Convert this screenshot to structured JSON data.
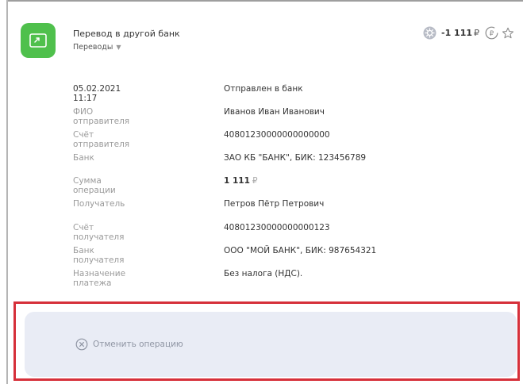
{
  "header": {
    "title": "Перевод в другой банк",
    "category": "Переводы",
    "amount": "-1 111",
    "currency": "₽"
  },
  "colors": {
    "app_icon_bg": "#4fc04c",
    "highlight_border": "#d6303a",
    "panel_bg": "#e9ecf5"
  },
  "icons": {
    "app": "transfer-arrows-icon",
    "bonus": "bonus-badge-icon",
    "cashback": "rouble-cashback-icon",
    "favorite": "star-icon",
    "cancel": "close-circle-icon"
  },
  "details": {
    "datetime": "05.02.2021 11:17",
    "status": "Отправлен в банк",
    "rows": [
      {
        "label": "ФИО отправителя",
        "value": "Иванов Иван Иванович"
      },
      {
        "label": "Счёт отправителя",
        "value": "40801230000000000000"
      },
      {
        "label": "Банк",
        "value": "ЗАО КБ \"БАНК\", БИК: 123456789"
      },
      {
        "label": "Сумма операции",
        "value": "1 111",
        "currency": "₽"
      },
      {
        "label": "Получатель",
        "value": "Петров Пётр Петрович"
      },
      {
        "label": "Счёт получателя",
        "value": "40801230000000000123"
      },
      {
        "label": "Банк получателя",
        "value": "ООО \"МОЙ БАНК\", БИК: 987654321"
      },
      {
        "label": "Назначение платежа",
        "value": "Без налога (НДС)."
      }
    ]
  },
  "actions": {
    "cancel_label": "Отменить операцию"
  }
}
